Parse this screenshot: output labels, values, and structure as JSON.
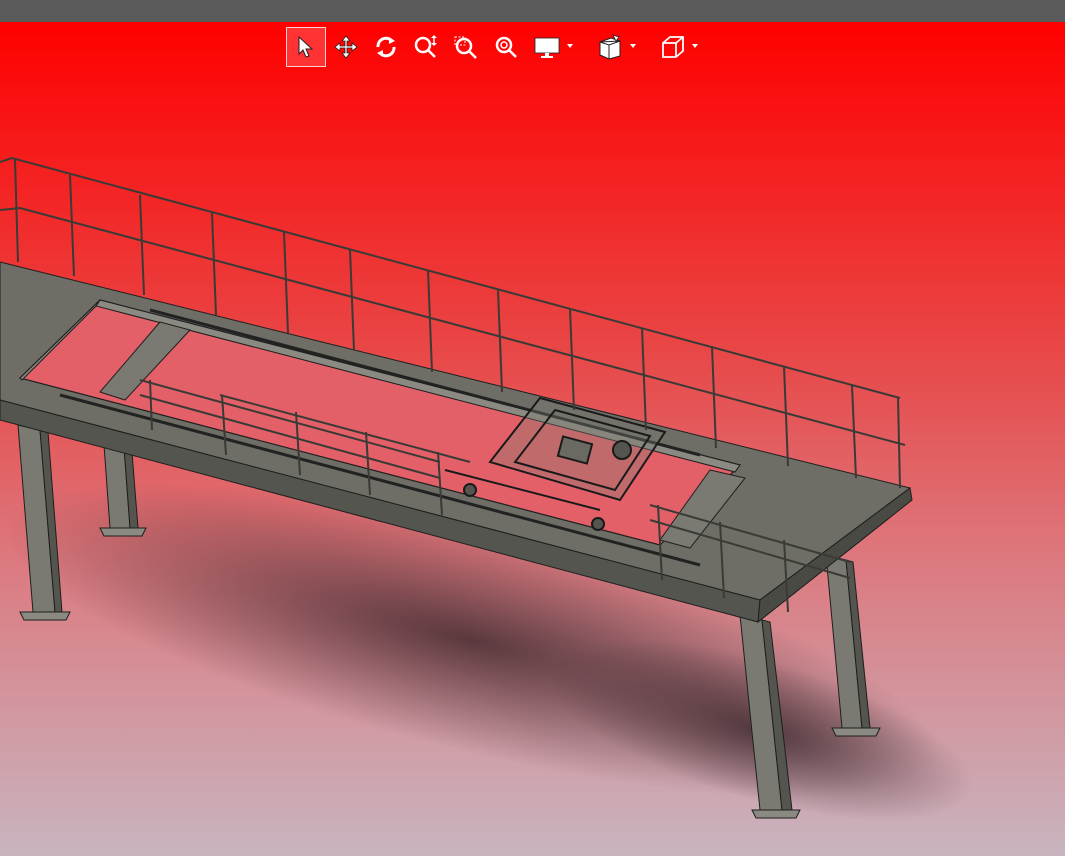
{
  "window": {
    "title_bar_color": "#5a5a5a"
  },
  "viewport": {
    "background_top": "#ff0000",
    "background_bottom": "#c8b4bf",
    "model": "structural-walkway-platform"
  },
  "toolbar": {
    "items": [
      {
        "name": "select-tool",
        "icon": "cursor-arrow-icon",
        "selected": true
      },
      {
        "name": "pan-tool",
        "icon": "move-arrows-icon"
      },
      {
        "name": "rotate-tool",
        "icon": "rotate-icon"
      },
      {
        "name": "zoom-tool",
        "icon": "zoom-icon"
      },
      {
        "name": "zoom-window-tool",
        "icon": "zoom-window-icon"
      },
      {
        "name": "zoom-fit-tool",
        "icon": "zoom-fit-icon"
      },
      {
        "name": "display-dropdown",
        "icon": "monitor-icon",
        "has_dropdown": true
      },
      {
        "name": "view-orientation-dropdown",
        "icon": "orientation-cube-icon",
        "has_dropdown": true
      },
      {
        "name": "standard-views-dropdown",
        "icon": "cube-icon",
        "has_dropdown": true
      }
    ]
  },
  "colors": {
    "steel": "#7a7a72",
    "steel_dark": "#4e4e48",
    "edge": "#1e1e1e",
    "shadow": "#3a2328"
  }
}
